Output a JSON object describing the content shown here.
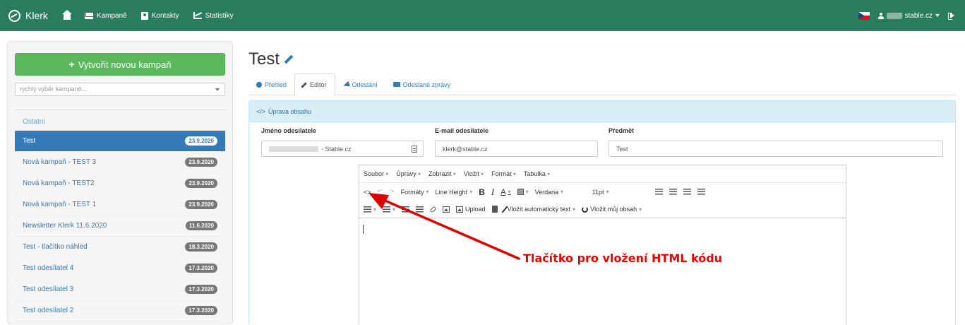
{
  "navbar": {
    "brand": "Klerk",
    "items": [
      {
        "label": "Kampaně",
        "icon": "mail-icon"
      },
      {
        "label": "Kontakty",
        "icon": "contact-icon"
      },
      {
        "label": "Statistiky",
        "icon": "chart-icon"
      }
    ],
    "user_label": "stable.cz"
  },
  "sidebar": {
    "create_button": "Vytvořit novou kampaň",
    "quick_select_placeholder": "rychlý výběr kampaně...",
    "group_label": "Ostatní",
    "campaigns": [
      {
        "name": "Test",
        "date": "23.9.2020",
        "active": true
      },
      {
        "name": "Nová kampaň - TEST 3",
        "date": "23.9.2020"
      },
      {
        "name": "Nová kampaň - TEST2",
        "date": "23.9.2020"
      },
      {
        "name": "Nová kampaň - TEST 1",
        "date": "23.9.2020"
      },
      {
        "name": "Newsletter Klerk 11.6.2020",
        "date": "11.6.2020"
      },
      {
        "name": "Test - tlačítko náhled",
        "date": "18.3.2020"
      },
      {
        "name": "Test odesílatel 4",
        "date": "17.3.2020"
      },
      {
        "name": "Test odesílatel 3",
        "date": "17.3.2020"
      },
      {
        "name": "Test odesílatel 2",
        "date": "17.3.2020"
      }
    ]
  },
  "main": {
    "title": "Test",
    "tabs": [
      {
        "label": "Přehled",
        "icon": "info-icon"
      },
      {
        "label": "Editor",
        "icon": "pencil-icon",
        "active": true
      },
      {
        "label": "Odeslání",
        "icon": "send-icon"
      },
      {
        "label": "Odeslané zprávy",
        "icon": "envelope-icon"
      }
    ],
    "panel_title": "Úprava obsahu",
    "fields": {
      "sender_name_label": "Jméno odesilatele",
      "sender_name_value": "- Stable.cz",
      "email_label": "E-mail odesilatele",
      "email_value": "klerk@stable.cz",
      "subject_label": "Předmět",
      "subject_value": "Test"
    }
  },
  "editor": {
    "menu": [
      "Soubor",
      "Úpravy",
      "Zobrazit",
      "Vložit",
      "Formát",
      "Tabulka"
    ],
    "toolbar": {
      "source_code": "<>",
      "formats": "Formáty",
      "line_height": "Line Height",
      "bold": "B",
      "italic": "I",
      "font_color": "A",
      "font_family": "Verdana",
      "font_size": "11pt",
      "upload": "Upload",
      "insert_auto_text": "Vložit automatický text",
      "insert_my_content": "Vložit můj obsah"
    }
  },
  "annotation": {
    "text": "Tlačítko pro vložení HTML kódu",
    "color": "#e00000"
  },
  "colors": {
    "navbar": "#2a7d5c",
    "primary": "#337ab7",
    "success": "#5cb85c",
    "panel_head": "#d9edf7"
  }
}
